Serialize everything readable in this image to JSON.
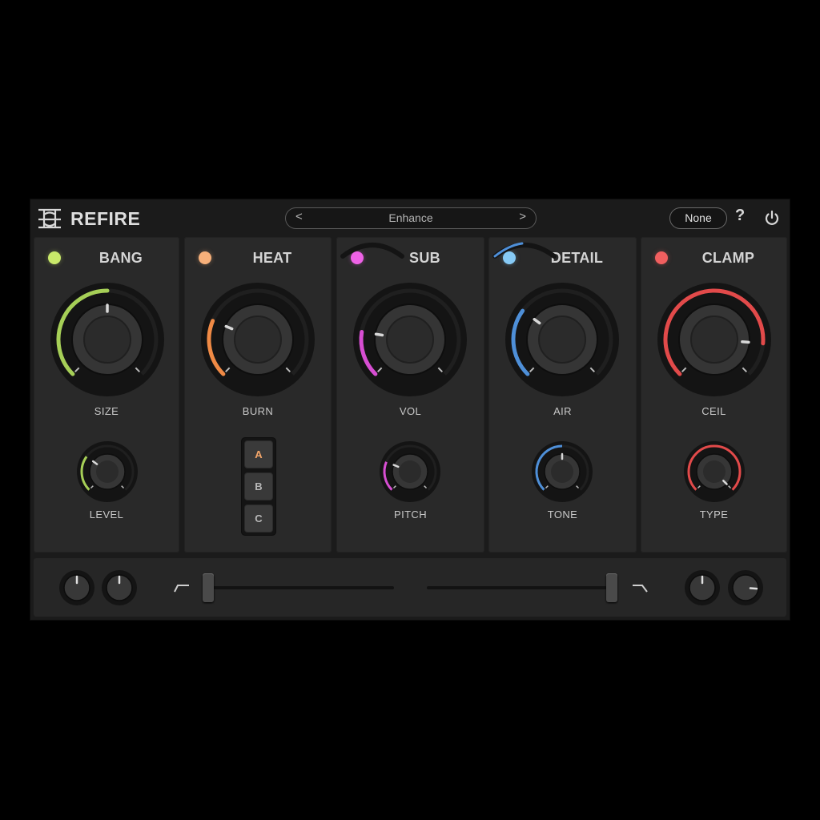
{
  "app": {
    "title": "REFIRE"
  },
  "preset": {
    "prev": "<",
    "name": "Enhance",
    "next": ">"
  },
  "header": {
    "none_label": "None",
    "help_label": "?"
  },
  "modules": [
    {
      "title": "BANG",
      "led": "#c9e96a",
      "color": "#a6cf57",
      "knob_label": "SIZE",
      "knob_value": 0.5,
      "small_label": "LEVEL",
      "small_value": 0.3,
      "small_color": "#a6cf57"
    },
    {
      "title": "HEAT",
      "led": "#f7b07a",
      "color": "#f08a45",
      "knob_label": "BURN",
      "knob_value": 0.25,
      "ab": [
        "A",
        "B",
        "C"
      ],
      "ab_active": "A"
    },
    {
      "title": "SUB",
      "led": "#ee62e6",
      "color": "#d74ed2",
      "knob_label": "VOL",
      "knob_value": 0.2,
      "small_label": "PITCH",
      "small_value": 0.25,
      "small_color": "#d74ed2"
    },
    {
      "title": "DETAIL",
      "led": "#86caf6",
      "color": "#4e8fd8",
      "knob_label": "AIR",
      "knob_value": 0.3,
      "small_label": "TONE",
      "small_value": 0.5,
      "small_color": "#4e8fd8"
    },
    {
      "title": "CLAMP",
      "led": "#f15f5f",
      "color": "#e24a4a",
      "knob_label": "CEIL",
      "knob_value": 0.85,
      "small_label": "TYPE",
      "small_value": 1.0,
      "small_color": "#e24a4a"
    }
  ],
  "bottom": {
    "low_cut_value": 0.0,
    "high_cut_value": 1.0,
    "knobs": [
      {
        "name": "input-knob",
        "value": 0.5
      },
      {
        "name": "drive-knob",
        "value": 0.5
      },
      {
        "name": "mix-knob",
        "value": 0.5
      },
      {
        "name": "output-knob",
        "value": 0.85
      }
    ]
  },
  "icons": {
    "logo": "refire-logo-icon",
    "power": "power-icon"
  }
}
